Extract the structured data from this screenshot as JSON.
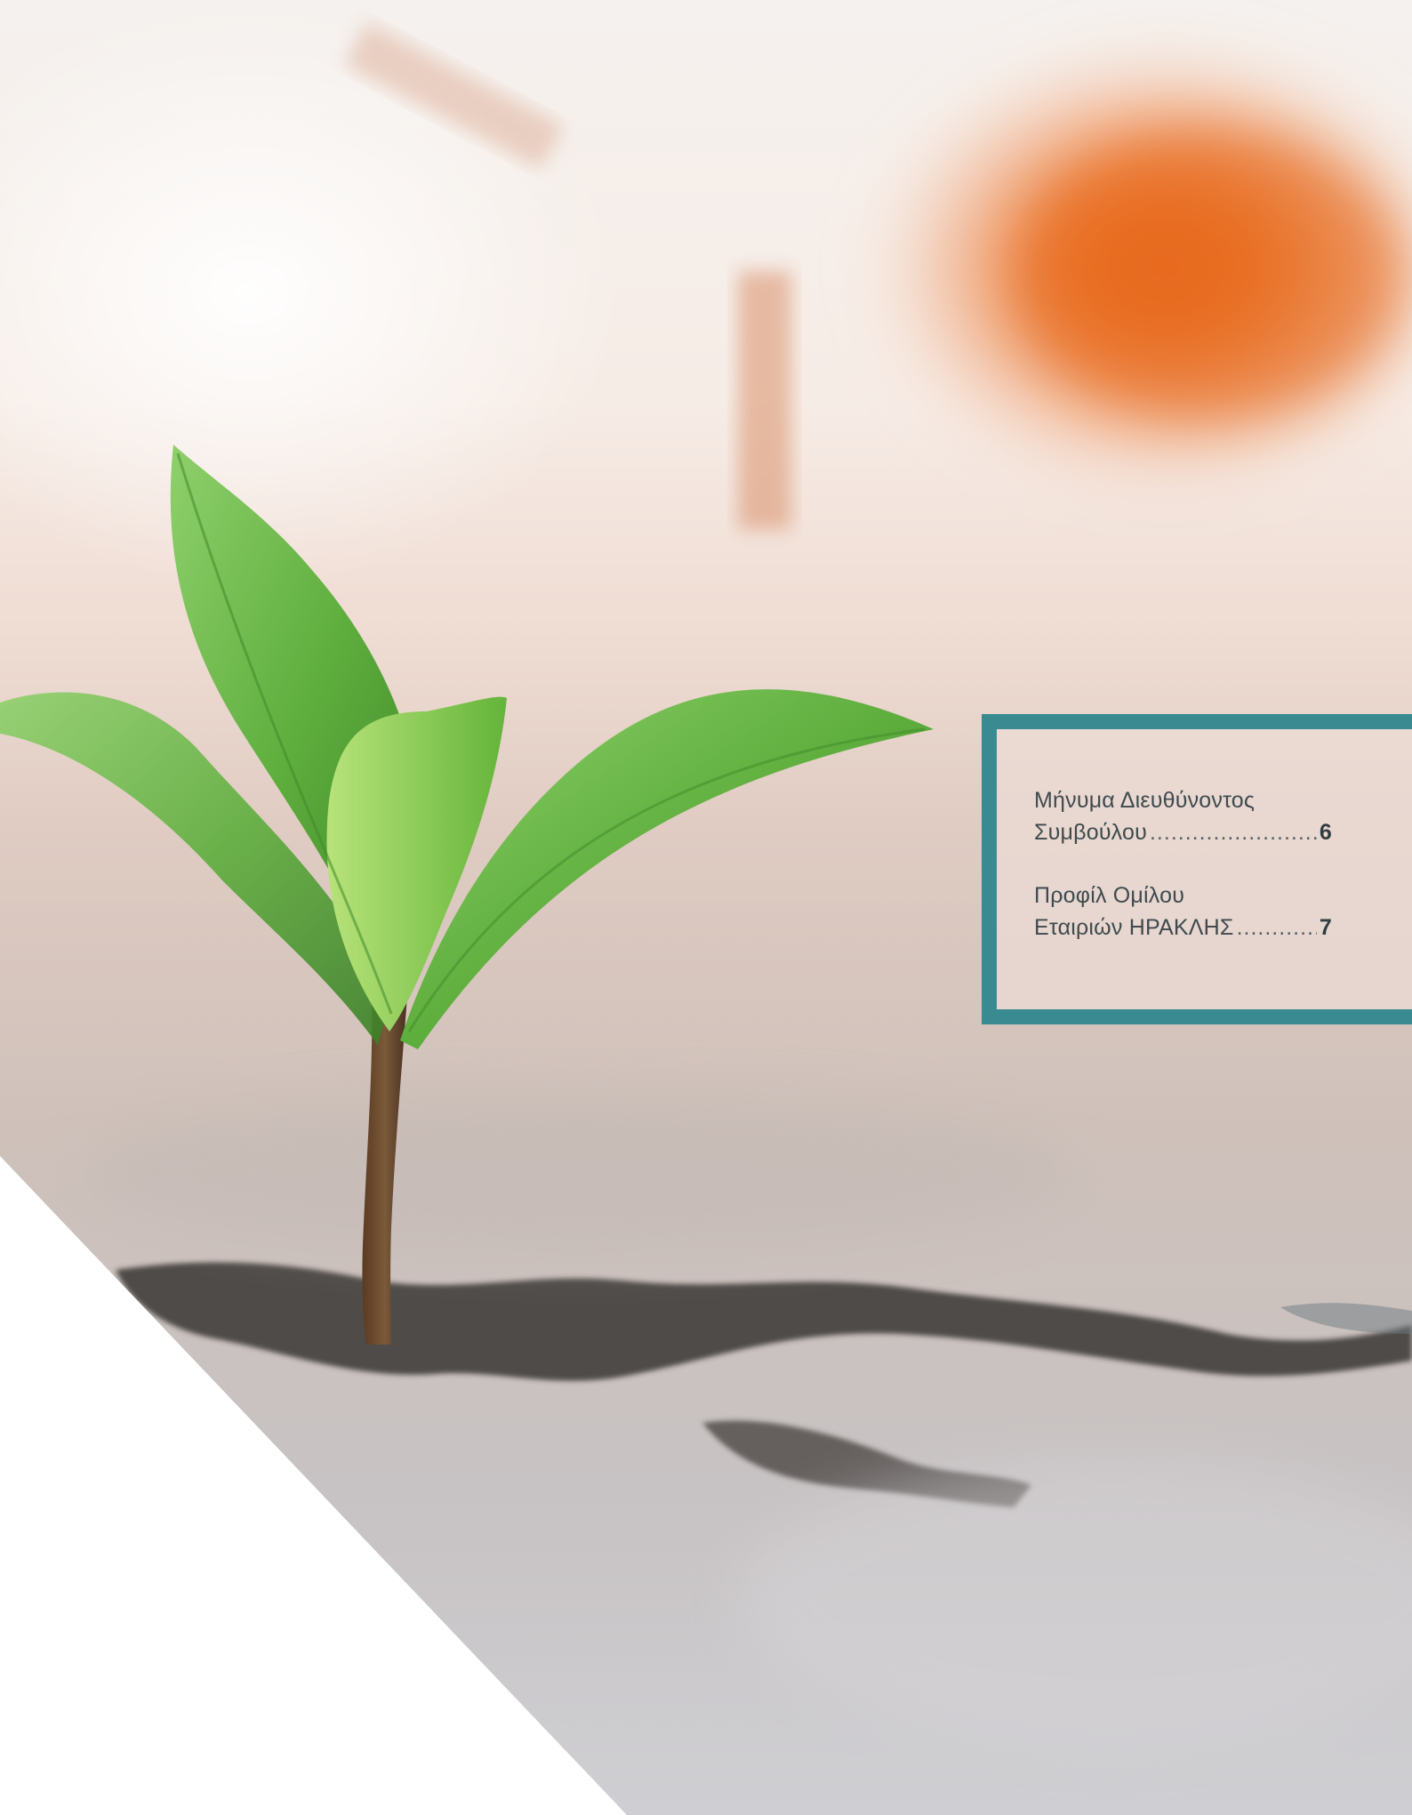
{
  "toc": {
    "entries": [
      {
        "title_line1": "Μήνυμα Διευθύνοντος",
        "title_line2": "Συμβούλου",
        "page": "6"
      },
      {
        "title_line1": "Προφίλ Ομίλου",
        "title_line2": "Εταιριών ΗΡΑΚΛΗΣ",
        "page": "7"
      }
    ],
    "leader": "....................................................",
    "frame_color": "#3a8b91"
  }
}
